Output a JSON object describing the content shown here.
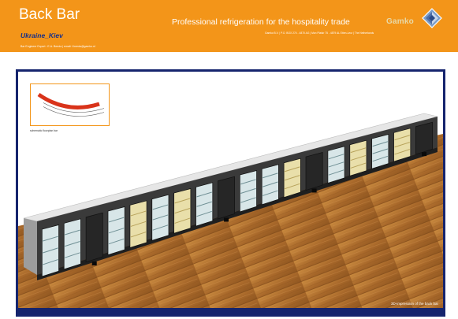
{
  "header": {
    "title": "Back Bar",
    "subtitle": "Ukraine_Kiev",
    "contact": "Bar Engineer Export  :  E.A. Beeda   |   email: f.beeda@gamko.nl",
    "tagline": "Professional refrigeration for the hospitality trade",
    "address": "Gamko B.V.   |   P.O. BOX 274 - 4870 AG   |   Mon Plaisir 75 - 4879 AL Etten-Leur   |   The Netherlands",
    "brand": "Gamko",
    "logo_icon": "gamko-diamond-logo-icon"
  },
  "inset": {
    "label": "schematic floorplan bar"
  },
  "render": {
    "caption": "3D-impression of the back bar"
  },
  "colors": {
    "header_orange": "#f39519",
    "frame_blue": "#15246d",
    "subtitle_blue": "#17308a",
    "bar_red": "#d9331a",
    "floor_wood": "#b5732f"
  }
}
